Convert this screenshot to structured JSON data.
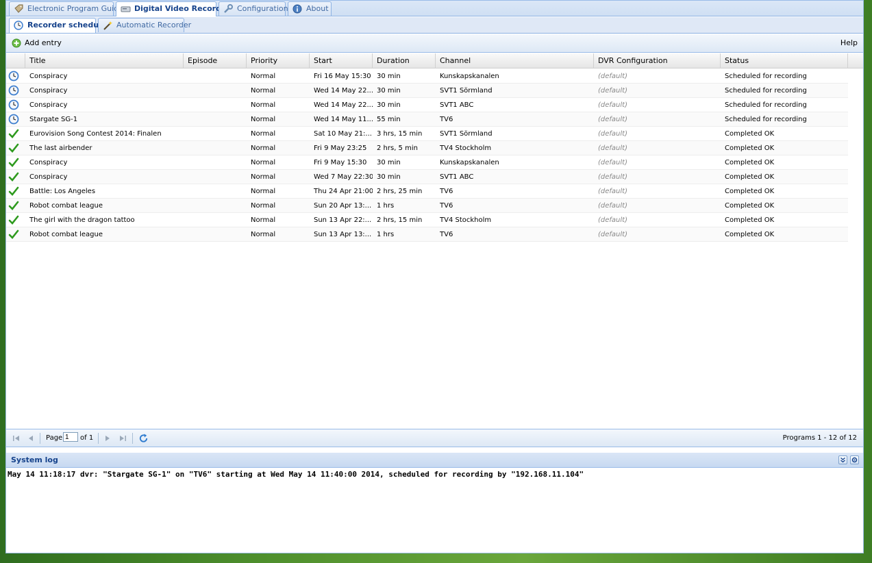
{
  "main_tabs": [
    {
      "label": "Electronic Program Guide",
      "icon": "tag-icon"
    },
    {
      "label": "Digital Video Recorder",
      "icon": "recorder-icon"
    },
    {
      "label": "Configuration",
      "icon": "wrench-icon"
    },
    {
      "label": "About",
      "icon": "info-icon"
    }
  ],
  "sub_tabs": [
    {
      "label": "Recorder schedule",
      "icon": "clock-icon"
    },
    {
      "label": "Automatic Recorder",
      "icon": "wand-icon"
    }
  ],
  "toolbar": {
    "add_label": "Add entry",
    "help_label": "Help"
  },
  "grid": {
    "columns": [
      "Title",
      "Episode",
      "Priority",
      "Start",
      "Duration",
      "Channel",
      "DVR Configuration",
      "Status"
    ],
    "rows": [
      {
        "status_icon": "scheduled",
        "title": "Conspiracy",
        "episode": "",
        "priority": "Normal",
        "start": "Fri 16 May 15:30",
        "duration": "30 min",
        "channel": "Kunskapskanalen",
        "config": "(default)",
        "status": "Scheduled for recording"
      },
      {
        "status_icon": "scheduled",
        "title": "Conspiracy",
        "episode": "",
        "priority": "Normal",
        "start": "Wed 14 May 22...",
        "duration": "30 min",
        "channel": "SVT1 Sörmland",
        "config": "(default)",
        "status": "Scheduled for recording"
      },
      {
        "status_icon": "scheduled",
        "title": "Conspiracy",
        "episode": "",
        "priority": "Normal",
        "start": "Wed 14 May 22...",
        "duration": "30 min",
        "channel": "SVT1 ABC",
        "config": "(default)",
        "status": "Scheduled for recording"
      },
      {
        "status_icon": "scheduled",
        "title": "Stargate SG-1",
        "episode": "",
        "priority": "Normal",
        "start": "Wed 14 May 11...",
        "duration": "55 min",
        "channel": "TV6",
        "config": "(default)",
        "status": "Scheduled for recording"
      },
      {
        "status_icon": "completed",
        "title": "Eurovision Song Contest 2014: Finalen",
        "episode": "",
        "priority": "Normal",
        "start": "Sat 10 May 21:...",
        "duration": "3 hrs, 15 min",
        "channel": "SVT1 Sörmland",
        "config": "(default)",
        "status": "Completed OK"
      },
      {
        "status_icon": "completed",
        "title": "The last airbender",
        "episode": "",
        "priority": "Normal",
        "start": "Fri 9 May 23:25",
        "duration": "2 hrs, 5 min",
        "channel": "TV4 Stockholm",
        "config": "(default)",
        "status": "Completed OK"
      },
      {
        "status_icon": "completed",
        "title": "Conspiracy",
        "episode": "",
        "priority": "Normal",
        "start": "Fri 9 May 15:30",
        "duration": "30 min",
        "channel": "Kunskapskanalen",
        "config": "(default)",
        "status": "Completed OK"
      },
      {
        "status_icon": "completed",
        "title": "Conspiracy",
        "episode": "",
        "priority": "Normal",
        "start": "Wed 7 May 22:30",
        "duration": "30 min",
        "channel": "SVT1 ABC",
        "config": "(default)",
        "status": "Completed OK"
      },
      {
        "status_icon": "completed",
        "title": "Battle: Los Angeles",
        "episode": "",
        "priority": "Normal",
        "start": "Thu 24 Apr 21:00",
        "duration": "2 hrs, 25 min",
        "channel": "TV6",
        "config": "(default)",
        "status": "Completed OK"
      },
      {
        "status_icon": "completed",
        "title": "Robot combat league",
        "episode": "",
        "priority": "Normal",
        "start": "Sun 20 Apr 13:...",
        "duration": "1 hrs",
        "channel": "TV6",
        "config": "(default)",
        "status": "Completed OK"
      },
      {
        "status_icon": "completed",
        "title": "The girl with the dragon tattoo",
        "episode": "",
        "priority": "Normal",
        "start": "Sun 13 Apr 22:...",
        "duration": "2 hrs, 15 min",
        "channel": "TV4 Stockholm",
        "config": "(default)",
        "status": "Completed OK"
      },
      {
        "status_icon": "completed",
        "title": "Robot combat league",
        "episode": "",
        "priority": "Normal",
        "start": "Sun 13 Apr 13:...",
        "duration": "1 hrs",
        "channel": "TV6",
        "config": "(default)",
        "status": "Completed OK"
      }
    ]
  },
  "paging": {
    "page_label": "Page",
    "page_value": "1",
    "of_label": "of 1",
    "summary": "Programs 1 - 12 of 12"
  },
  "log": {
    "title": "System log",
    "lines": [
      "May 14 11:18:17 dvr: \"Stargate SG-1\" on \"TV6\" starting at Wed May 14 11:40:00 2014, scheduled for recording by \"192.168.11.104\""
    ]
  },
  "colors": {
    "accent": "#15428b",
    "border": "#99bbe8",
    "check": "#2e9a1e"
  }
}
